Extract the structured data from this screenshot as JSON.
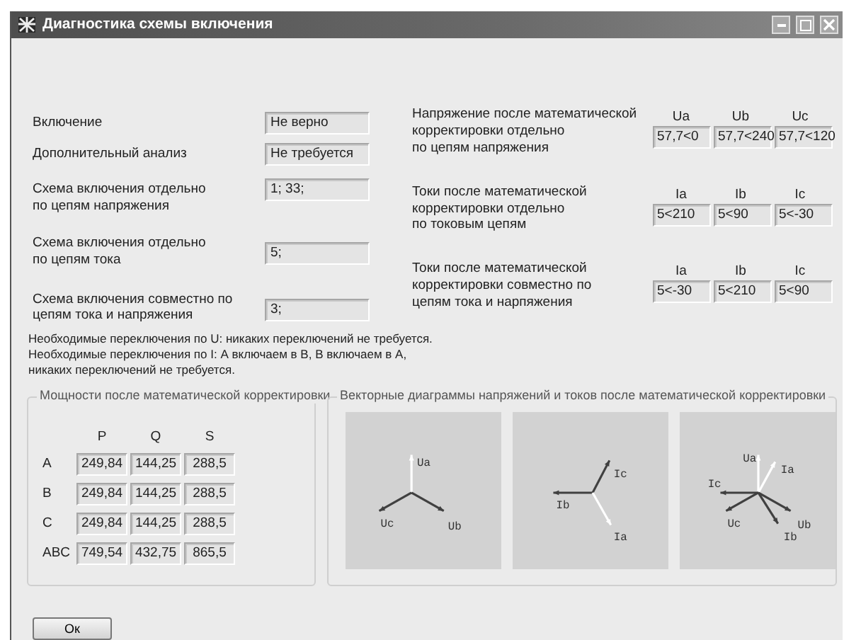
{
  "window": {
    "title": "Диагностика схемы включения"
  },
  "results": [
    {
      "label": "Включение",
      "value": "Не верно"
    },
    {
      "label": "Дополнительный анализ",
      "value": "Не требуется"
    },
    {
      "label": "Схема включения отдельно\nпо цепям напряжения",
      "value": "1; 33;"
    },
    {
      "label": "Схема включения отдельно\nпо цепям тока",
      "value": "5;"
    },
    {
      "label": "Схема включения совместно по\nцепям тока и  напряжения",
      "value": "3;"
    }
  ],
  "corrections": [
    {
      "label": "Напряжение после математической\nкорректировки отдельно\nпо цепям напряжения",
      "columns": [
        "Ua",
        "Ub",
        "Uc"
      ],
      "values": [
        "57,7<0",
        "57,7<240",
        "57,7<120"
      ]
    },
    {
      "label": "Токи после математической\nкорректировки отдельно\nпо токовым цепям",
      "columns": [
        "Ia",
        "Ib",
        "Ic"
      ],
      "values": [
        "5<210",
        "5<90",
        "5<-30"
      ]
    },
    {
      "label": "Токи после математической\nкорректировки совместно по\nцепям тока и нарпяжения",
      "columns": [
        "Ia",
        "Ib",
        "Ic"
      ],
      "values": [
        "5<-30",
        "5<210",
        "5<90"
      ]
    }
  ],
  "notes": [
    "Необходимые переключения по U: никаких переключений не требуется.",
    "Необходимые переключения по I: А включаем в В, В включаем в А,\n никаких переключений не требуется."
  ],
  "powers": {
    "title": "Мощности после математической корректировки",
    "columns": [
      "P",
      "Q",
      "S"
    ],
    "rows": [
      {
        "phase": "A",
        "values": [
          "249,84",
          "144,25",
          "288,5"
        ]
      },
      {
        "phase": "B",
        "values": [
          "249,84",
          "144,25",
          "288,5"
        ]
      },
      {
        "phase": "C",
        "values": [
          "249,84",
          "144,25",
          "288,5"
        ]
      },
      {
        "phase": "ABC",
        "values": [
          "749,54",
          "432,75",
          "865,5"
        ]
      }
    ]
  },
  "diagrams": {
    "title": "Векторные диаграммы напряжений и токов после математической корректировки",
    "panels": [
      {
        "vectors": [
          {
            "label": "Ua",
            "color": "#ffffff"
          },
          {
            "label": "Uc",
            "color": "#404040"
          },
          {
            "label": "Ub",
            "color": "#404040"
          }
        ]
      },
      {
        "vectors": [
          {
            "label": "Ic",
            "color": "#404040"
          },
          {
            "label": "Ib",
            "color": "#404040"
          },
          {
            "label": "Ia",
            "color": "#ffffff"
          }
        ]
      },
      {
        "vectors": [
          {
            "label": "Ua",
            "color": "#ffffff"
          },
          {
            "label": "Ia",
            "color": "#ffffff"
          },
          {
            "label": "Ic",
            "color": "#404040"
          },
          {
            "label": "Uc",
            "color": "#404040"
          },
          {
            "label": "Ub",
            "color": "#404040"
          },
          {
            "label": "Ib",
            "color": "#404040"
          }
        ]
      }
    ]
  },
  "buttons": [
    "Ок"
  ]
}
